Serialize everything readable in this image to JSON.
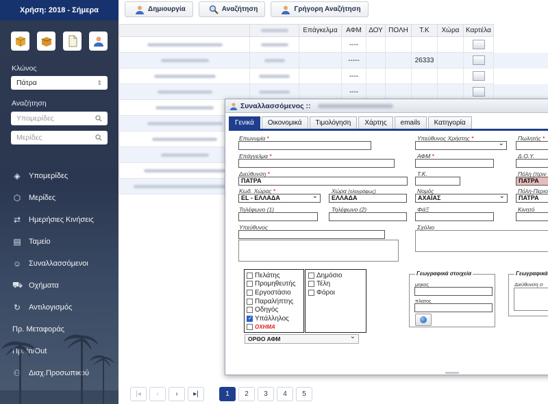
{
  "brand": "Χρήση: 2018 - Σήμερα",
  "sidebar": {
    "branch_label": "Κλώνος",
    "branch_value": "Πάτρα",
    "search_label": "Αναζήτηση",
    "search1_placeholder": "Υπομερίδες",
    "search2_placeholder": "Μερίδες",
    "menu": [
      {
        "label": "Υπομερίδες",
        "icon": "layers-icon"
      },
      {
        "label": "Μερίδες",
        "icon": "cube-icon"
      },
      {
        "label": "Ημερήσιες Κινήσεις",
        "icon": "arrows-icon"
      },
      {
        "label": "Ταμείο",
        "icon": "cash-icon"
      },
      {
        "label": "Συναλλασσόμενοι",
        "icon": "users-icon"
      },
      {
        "label": "Οχήματα",
        "icon": "car-icon"
      },
      {
        "label": "Αντιλογισμός",
        "icon": "refresh-icon"
      },
      {
        "label": "Πρ. Μεταφοράς",
        "icon": ""
      },
      {
        "label": "Πρ. In/Out",
        "icon": ""
      },
      {
        "label": "Διαχ.Προσωπικού",
        "icon": "staff-icon"
      }
    ]
  },
  "toolbar": {
    "create": "Δημιουργία",
    "search": "Αναζήτηση",
    "quick_search": "Γρήγορη Αναζήτηση"
  },
  "grid": {
    "headers": [
      "",
      "",
      "Επάγκελμα",
      "ΑΦΜ",
      "ΔΟΥ",
      "ΠΟΛΗ",
      "Τ.Κ",
      "Χώρα",
      "Καρτέλα"
    ],
    "rows": [
      {
        "afm": "----",
        "tk": ""
      },
      {
        "afm": "-----",
        "tk": "26333"
      },
      {
        "afm": "----",
        "tk": ""
      },
      {
        "afm": "----",
        "tk": ""
      },
      {
        "afm": "",
        "tk": ""
      },
      {
        "afm": "",
        "tk": ""
      },
      {
        "afm": "",
        "tk": ""
      },
      {
        "afm": "",
        "tk": ""
      },
      {
        "afm": "",
        "tk": ""
      },
      {
        "afm": "",
        "tk": ""
      }
    ]
  },
  "pager": {
    "first": "|◂",
    "prev": "‹",
    "next": "›",
    "last": "▸|",
    "pages": [
      "1",
      "2",
      "3",
      "4",
      "5"
    ]
  },
  "dialog": {
    "title": "Συναλλασσόμενος ::",
    "tabs": [
      "Γενικά",
      "Οικονομικά",
      "Τιμολόγηση",
      "Χάρτης",
      "emails",
      "Κατηγορία"
    ],
    "labels": {
      "eponymia": "Επωνυμία",
      "epaggelma": "Επάγγελμα",
      "dieuthynsi": "Διεύθυνση",
      "kod_xwras": "Κωδ. Χώρας",
      "xwra": "Χώρα",
      "xwra_sub": "(ολογράφως)",
      "tilefono1": "Τηλέφωνο (1)",
      "tilefono2": "Τηλέφωνο (2)",
      "ypeuthynos": "Υπεύθυνος",
      "ypeuthynos_xristis": "Υπεύθυνος Χρήστης",
      "afm": "ΑΦΜ",
      "tk": "Τ.Κ.",
      "nomos": "Νομός",
      "fax": "ΦάΞ",
      "sxolio": "Σχόλιο",
      "pwlitis": "Πωλητής",
      "doy": "Δ.Ο.Υ.",
      "poli": "Πόλη (πριν",
      "poli_perioxi": "Πόλη-Περιο",
      "kinito": "Κινητό",
      "mikos": "μηκος",
      "platos": "πλατος",
      "geo_partial": "Γεωγραφικά",
      "dieuthynsi_partial": "Διεύθυνση σ"
    },
    "values": {
      "dieuthynsi": "ΠΑΤΡΑ",
      "kod_xwras": "EL - ΕΛΛΑΔΑ",
      "xwra": "ΕΛΛΑΔΑ",
      "nomos": "ΑΧΑΪΑΣ",
      "poli": "ΠΑΤΡΑ",
      "poli_perioxi": "ΠΑΤΡΑ"
    },
    "roles": [
      {
        "label": "Πελάτης",
        "checked": false
      },
      {
        "label": "Προμηθευτής",
        "checked": false
      },
      {
        "label": "Εργοστάσιο",
        "checked": false
      },
      {
        "label": "Παραλήπτης",
        "checked": false
      },
      {
        "label": "Οδηγός",
        "checked": false
      },
      {
        "label": "Υπάλληλος",
        "checked": true
      },
      {
        "label": "ΟΧΗΜΑ",
        "checked": false
      }
    ],
    "public": [
      {
        "label": "Δημόσιο",
        "checked": false
      },
      {
        "label": "Τέλη",
        "checked": false
      },
      {
        "label": "Φόροι",
        "checked": false
      }
    ],
    "afm_select": "ΟΡΘΟ ΑΦΜ",
    "geo_legend": "Γεωγραφικά στοιχεία"
  },
  "colors": {
    "brand_bar": "#17336e",
    "accent": "#1f3f8e",
    "required": "#cc0000"
  }
}
